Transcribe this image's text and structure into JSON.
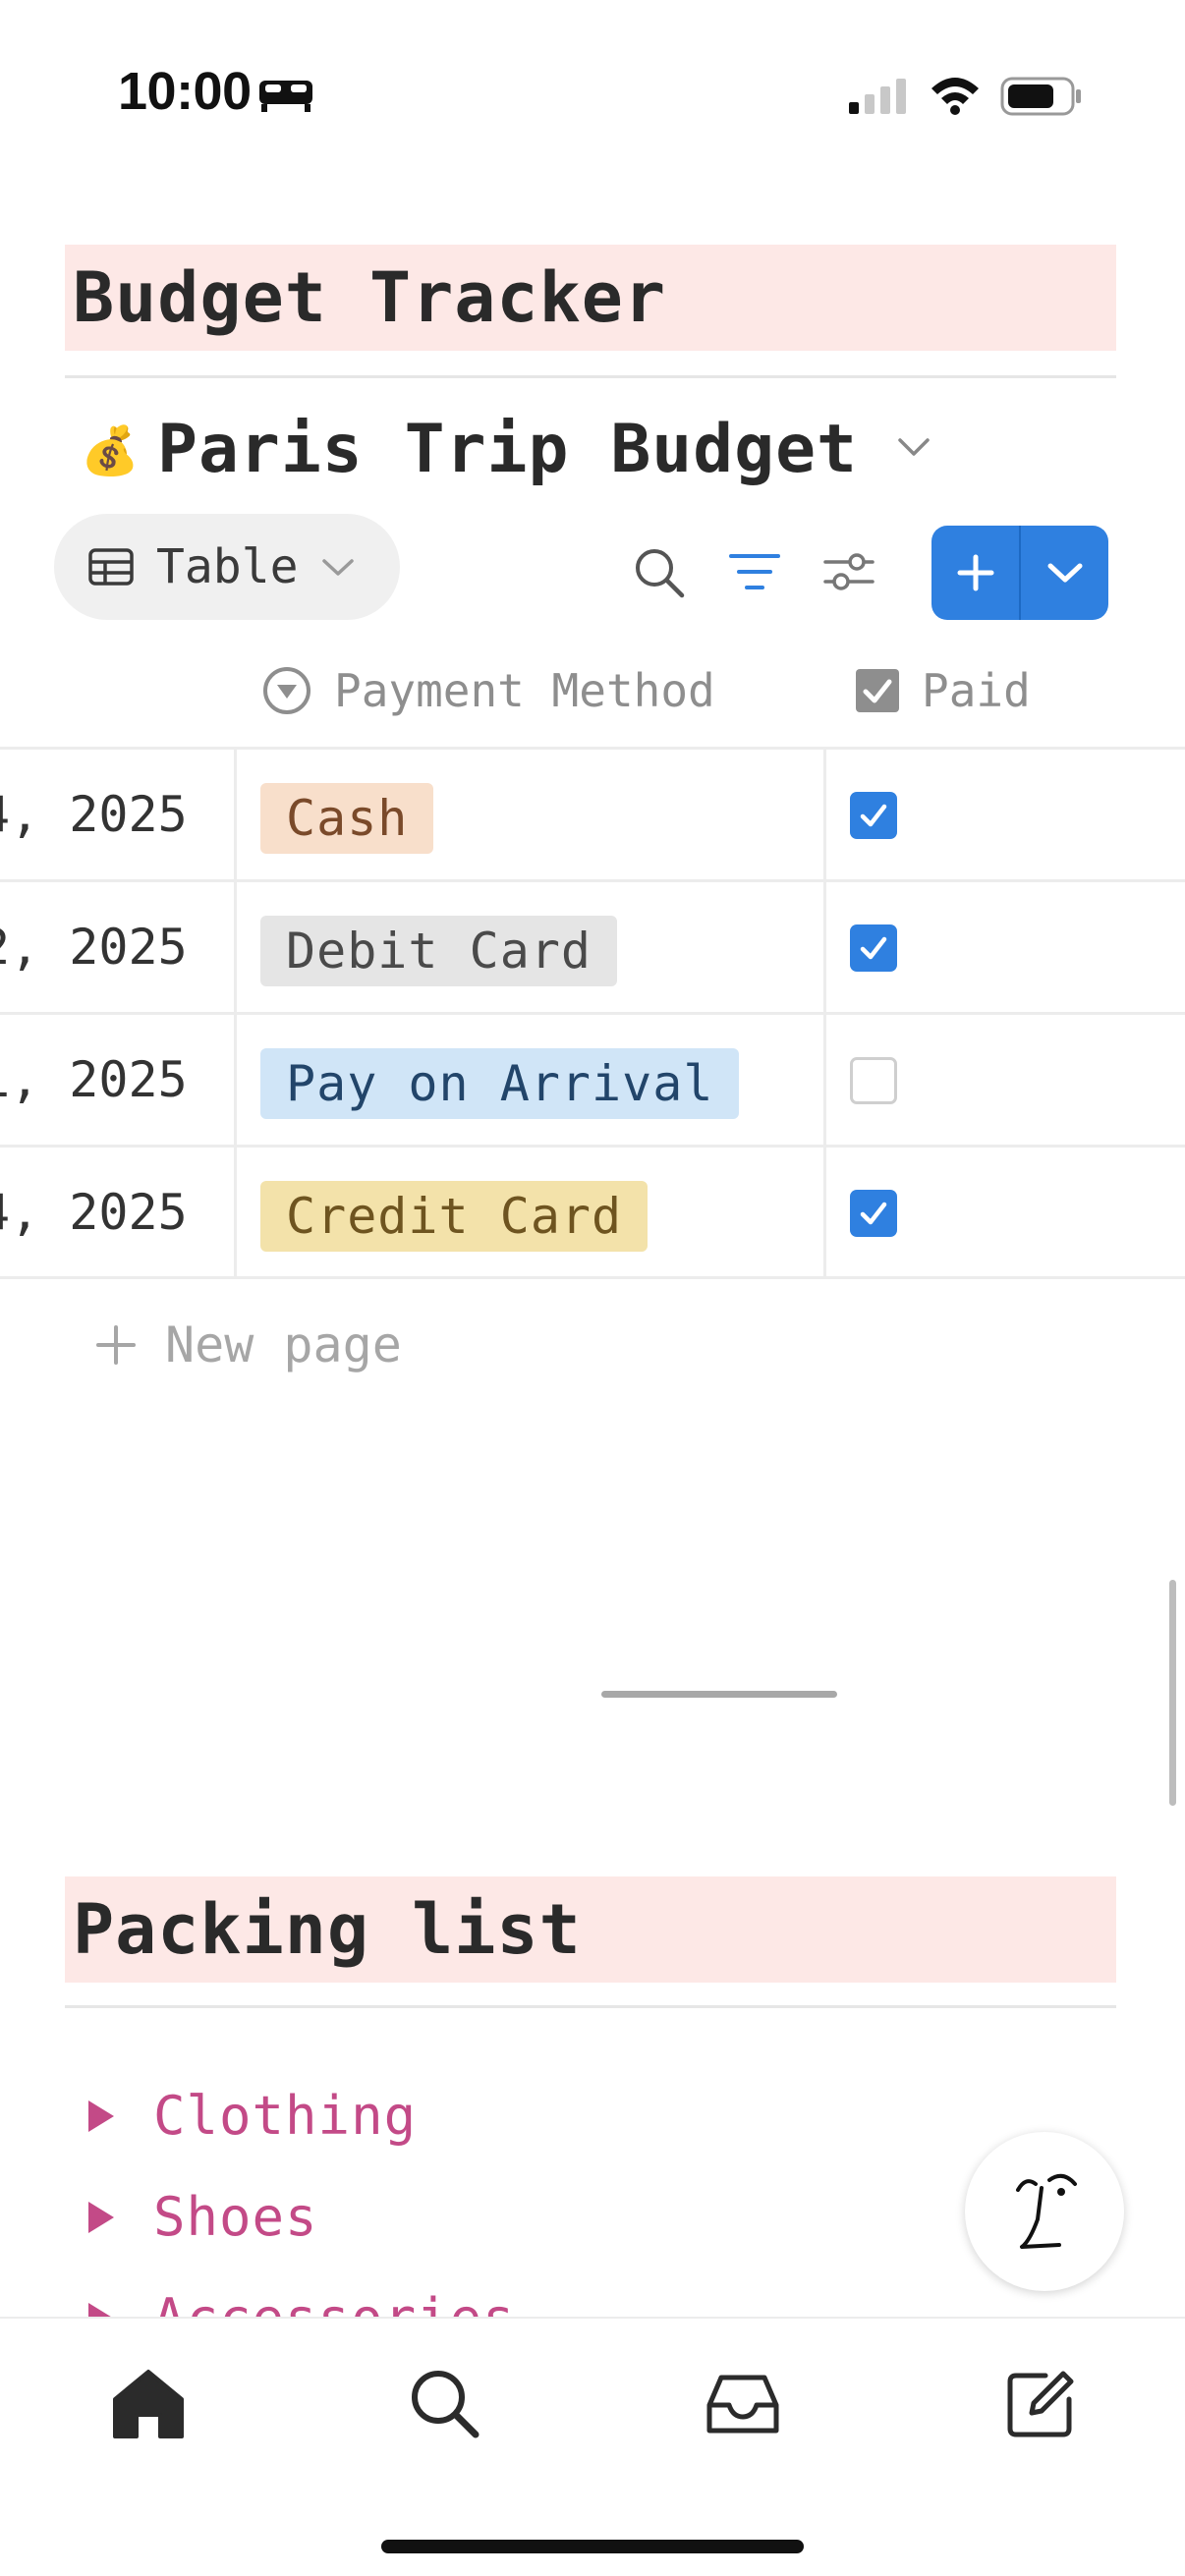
{
  "status_bar": {
    "time": "10:00",
    "icons": [
      "bed-icon",
      "cellular-signal-icon",
      "wifi-icon",
      "battery-icon"
    ]
  },
  "sections": [
    {
      "title": "Budget Tracker"
    },
    {
      "title": "Packing list"
    }
  ],
  "database": {
    "icon": "💰",
    "title": "Paris Trip Budget",
    "view": {
      "icon": "table-icon",
      "label": "Table"
    },
    "columns": [
      {
        "icon": "select-property-icon",
        "label": "Payment Method"
      },
      {
        "icon": "checkbox-property-icon",
        "label": "Paid"
      }
    ],
    "rows": [
      {
        "date": "4, 2025",
        "payment_method": "Cash",
        "tag_bg": "#f8dfcb",
        "tag_fg": "#7a4a2a",
        "paid": true
      },
      {
        "date": "2, 2025",
        "payment_method": "Debit Card",
        "tag_bg": "#e5e5e5",
        "tag_fg": "#4a4a4a",
        "paid": true
      },
      {
        "date": "1, 2025",
        "payment_method": "Pay on Arrival",
        "tag_bg": "#d0e5f7",
        "tag_fg": "#22456a",
        "paid": false
      },
      {
        "date": "4, 2025",
        "payment_method": "Credit Card",
        "tag_bg": "#f3e2aa",
        "tag_fg": "#6e5420",
        "paid": true
      }
    ],
    "new_page_label": "New page"
  },
  "packing_list": {
    "items": [
      "Clothing",
      "Shoes",
      "Accessories"
    ]
  },
  "bottom_nav": [
    "home-icon",
    "search-icon",
    "inbox-icon",
    "compose-icon"
  ],
  "colors": {
    "accent": "#2f80e0",
    "section_bg": "#fde8e6",
    "toggle_text": "#c34a87"
  }
}
